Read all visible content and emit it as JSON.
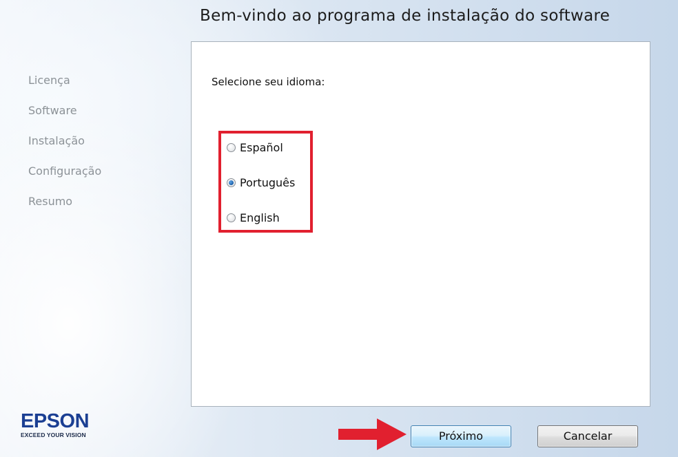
{
  "window": {
    "title": "Bem-vindo ao programa de instalação do software"
  },
  "steps": [
    {
      "label": "Licença"
    },
    {
      "label": "Software"
    },
    {
      "label": "Instalação"
    },
    {
      "label": "Configuração"
    },
    {
      "label": "Resumo"
    }
  ],
  "language_panel": {
    "prompt": "Selecione seu idioma:",
    "options": [
      {
        "label": "Español",
        "selected": false
      },
      {
        "label": "Português",
        "selected": true
      },
      {
        "label": "English",
        "selected": false
      }
    ],
    "highlight_color": "#e1202f"
  },
  "logo": {
    "brand": "EPSON",
    "tagline": "EXCEED YOUR VISION",
    "color": "#1b3f93"
  },
  "buttons": {
    "next_label": "Próximo",
    "cancel_label": "Cancelar"
  },
  "arrow": {
    "icon": "red-arrow-right-icon",
    "color": "#e1202f"
  }
}
